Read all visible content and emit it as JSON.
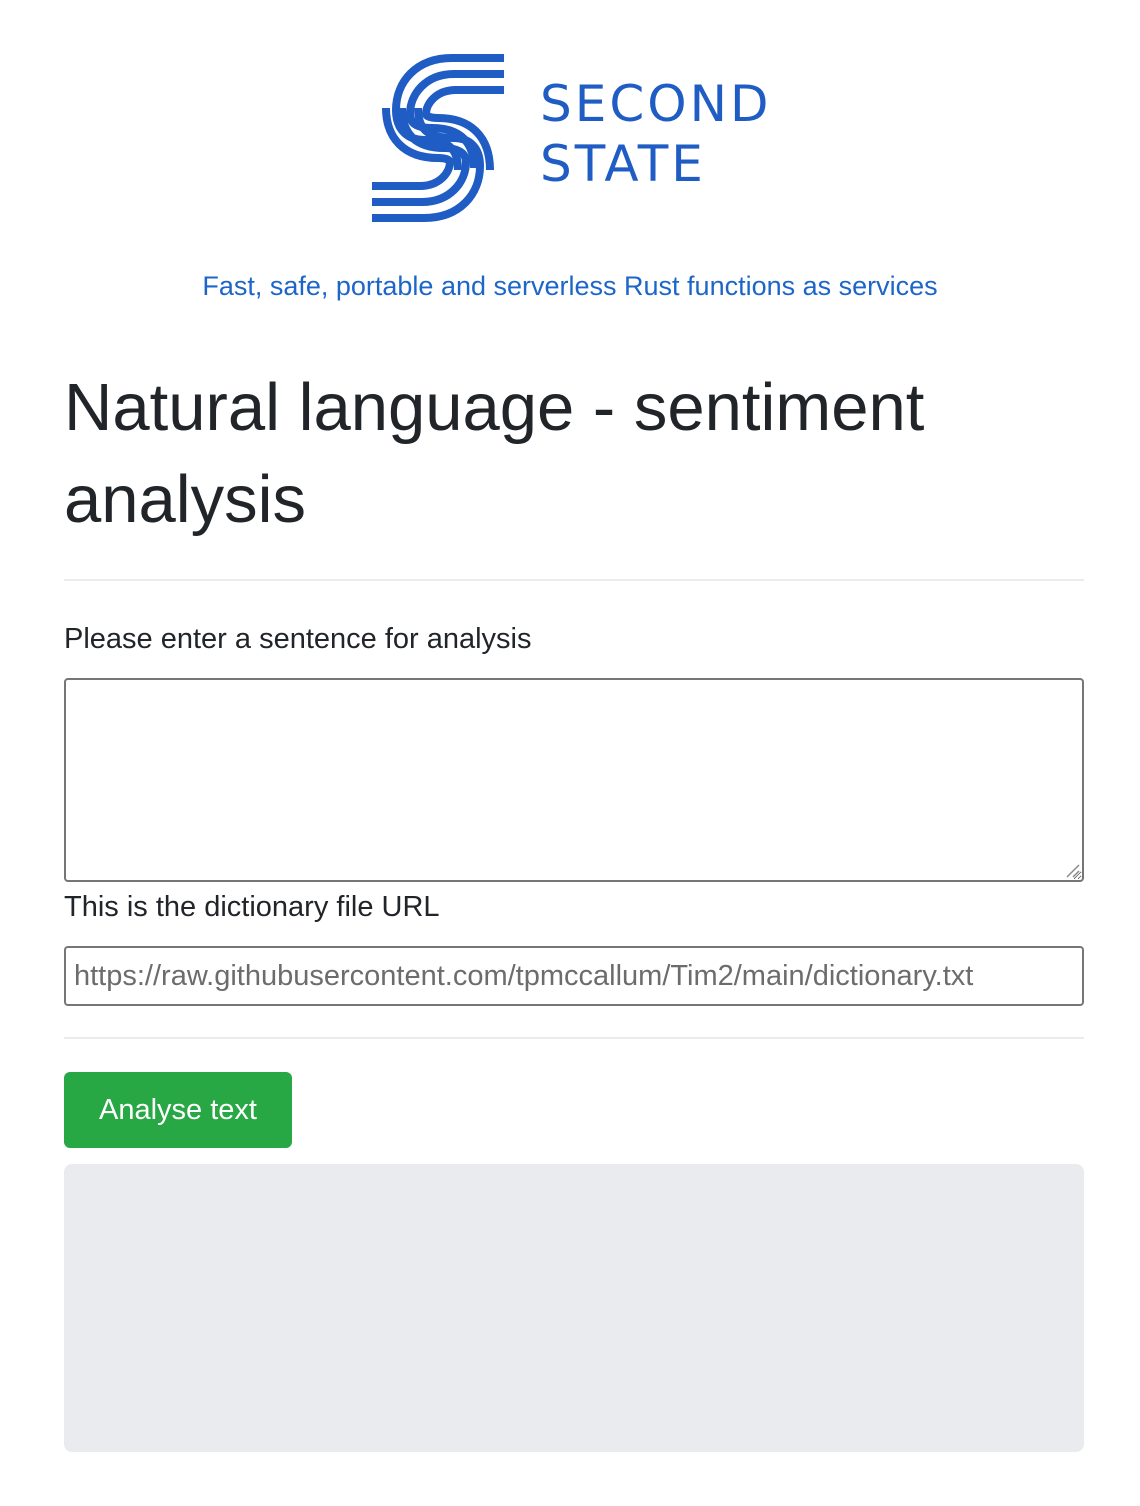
{
  "brand": {
    "logo_lines": [
      "SECOND",
      "STATE"
    ],
    "logo_icon": "second-state-logo-icon",
    "color": "#1f5cc4"
  },
  "tagline": "Fast, safe, portable and serverless Rust functions as services",
  "page_title": "Natural language - sentiment analysis",
  "form": {
    "sentence_label": "Please enter a sentence for analysis",
    "sentence_value": "",
    "dictionary_label": "This is the dictionary file URL",
    "dictionary_url": "https://raw.githubusercontent.com/tpmccallum/Tim2/main/dictionary.txt",
    "submit_label": "Analyse text"
  },
  "result": {
    "text": ""
  },
  "colors": {
    "accent_green": "#28a745",
    "link_blue": "#1d66c9",
    "result_background": "#e9ebef"
  }
}
